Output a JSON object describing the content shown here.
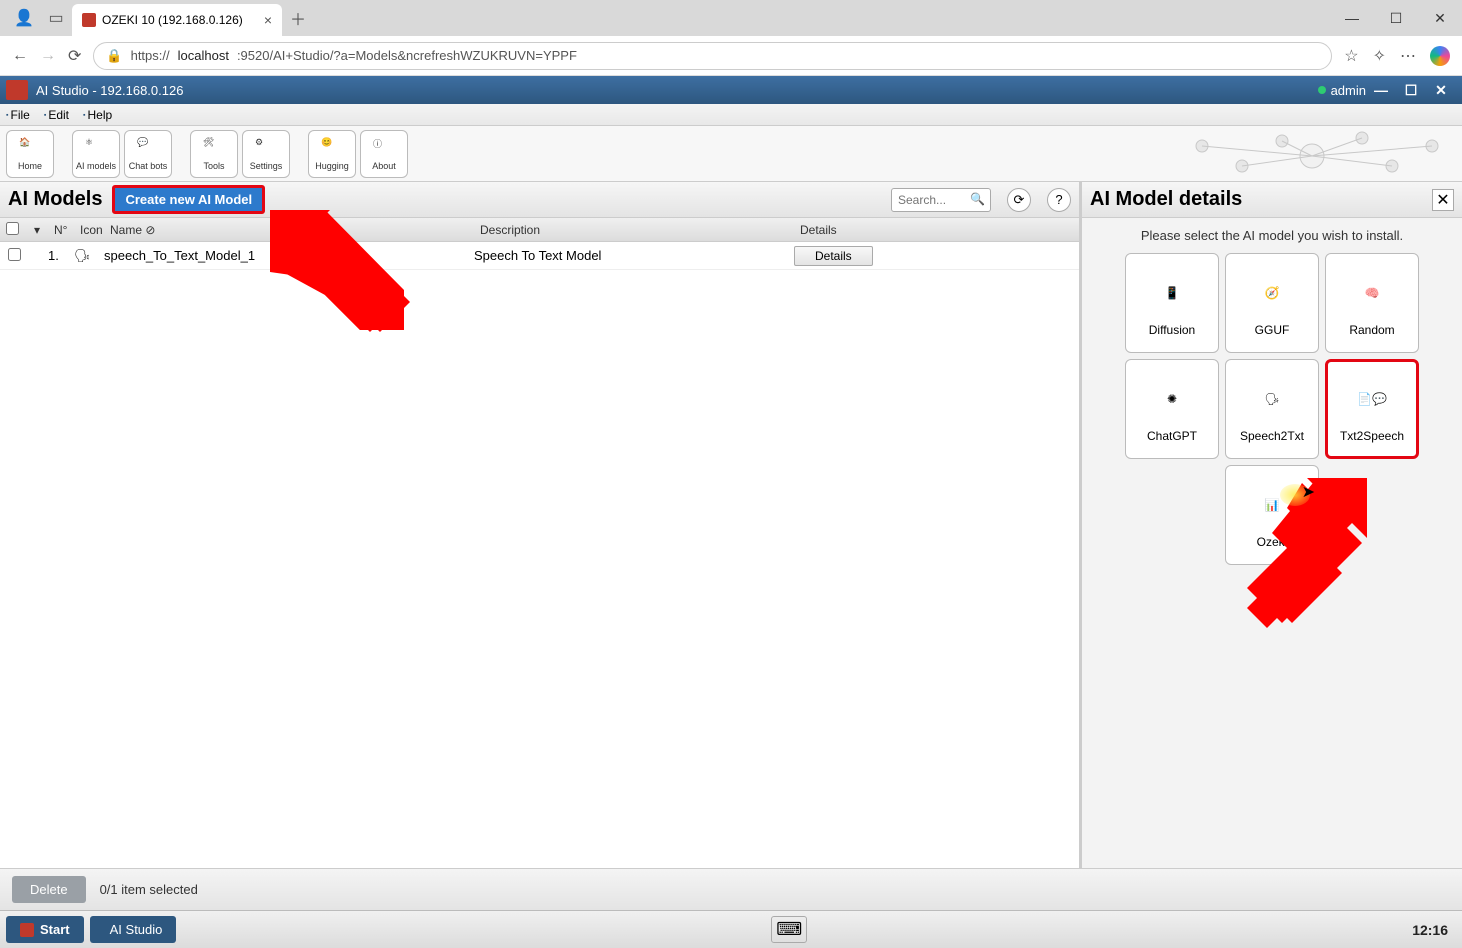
{
  "browser": {
    "tab_title": "OZEKI 10 (192.168.0.126)",
    "url_prefix": "https://",
    "url_host": "localhost",
    "url_rest": ":9520/AI+Studio/?a=Models&ncrefreshWZUKRUVN=YPPF"
  },
  "app": {
    "title": "AI Studio - 192.168.0.126",
    "user": "admin"
  },
  "menu": {
    "file": "File",
    "edit": "Edit",
    "help": "Help"
  },
  "toolbar": {
    "home": "Home",
    "models": "AI models",
    "chat": "Chat bots",
    "tools": "Tools",
    "settings": "Settings",
    "hugging": "Hugging",
    "about": "About"
  },
  "left": {
    "title": "AI Models",
    "create": "Create new AI Model",
    "search_ph": "Search...",
    "cols": {
      "n": "N°",
      "icon": "Icon",
      "name": "Name",
      "desc": "Description",
      "details": "Details"
    },
    "rows": [
      {
        "n": "1.",
        "name": "speech_To_Text_Model_1",
        "desc": "Speech To Text Model",
        "details": "Details"
      }
    ]
  },
  "right": {
    "title": "AI Model details",
    "hint": "Please select the AI model you wish to install.",
    "models": {
      "diffusion": "Diffusion",
      "gguf": "GGUF",
      "random": "Random",
      "chatgpt": "ChatGPT",
      "s2t": "Speech2Txt",
      "t2s": "Txt2Speech",
      "ozeki": "Ozeki"
    }
  },
  "footer": {
    "delete": "Delete",
    "selection": "0/1 item selected"
  },
  "taskbar": {
    "start": "Start",
    "app": "AI Studio",
    "time": "12:16"
  }
}
